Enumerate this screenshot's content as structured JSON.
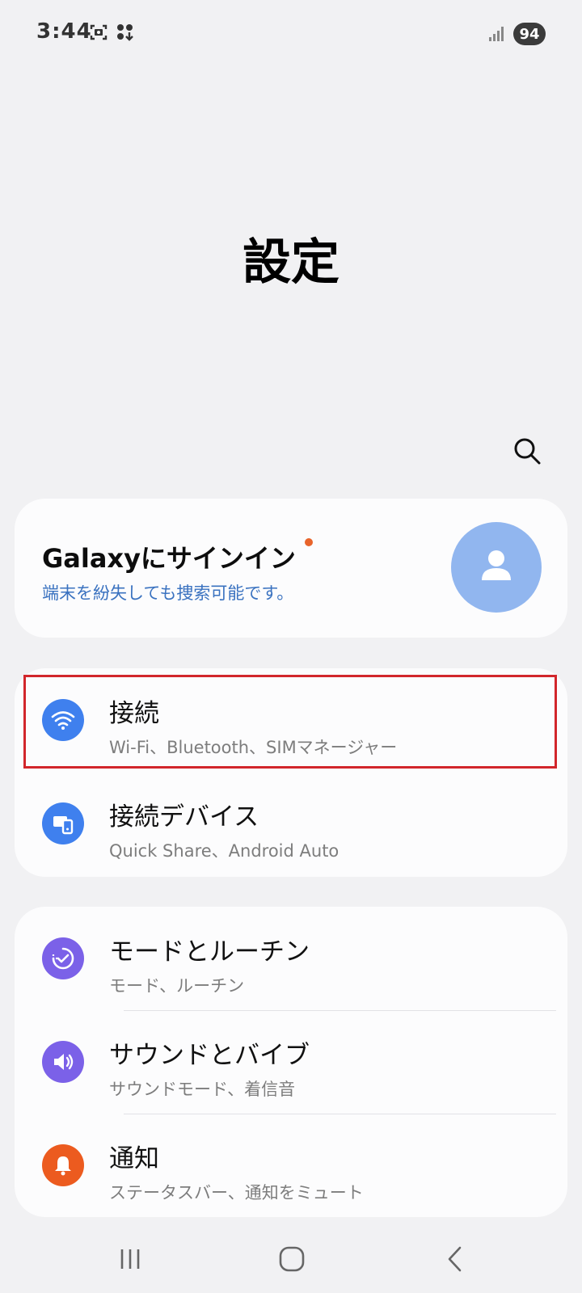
{
  "status_bar": {
    "time": "3:44",
    "battery": "94"
  },
  "header": {
    "title": "設定"
  },
  "account_card": {
    "title": "Galaxyにサインイン",
    "subtitle": "端末を紛失しても捜索可能です。"
  },
  "groups": [
    {
      "items": [
        {
          "title": "接続",
          "subtitle": "Wi-Fi、Bluetooth、SIMマネージャー",
          "icon": "wifi-icon",
          "color": "#3f80ee"
        },
        {
          "title": "接続デバイス",
          "subtitle": "Quick Share、Android Auto",
          "icon": "connected-devices-icon",
          "color": "#3f80ee"
        }
      ]
    },
    {
      "items": [
        {
          "title": "モードとルーチン",
          "subtitle": "モード、ルーチン",
          "icon": "modes-routines-icon",
          "color": "#7b61e8"
        },
        {
          "title": "サウンドとバイブ",
          "subtitle": "サウンドモード、着信音",
          "icon": "sound-icon",
          "color": "#7b61e8"
        },
        {
          "title": "通知",
          "subtitle": "ステータスバー、通知をミュート",
          "icon": "bell-icon",
          "color": "#ec5b1f"
        }
      ]
    }
  ],
  "colors": {
    "highlight": "#d2262b",
    "accent_blue": "#3f80ee",
    "accent_purple": "#7b61e8",
    "accent_orange": "#ec5b1f"
  }
}
